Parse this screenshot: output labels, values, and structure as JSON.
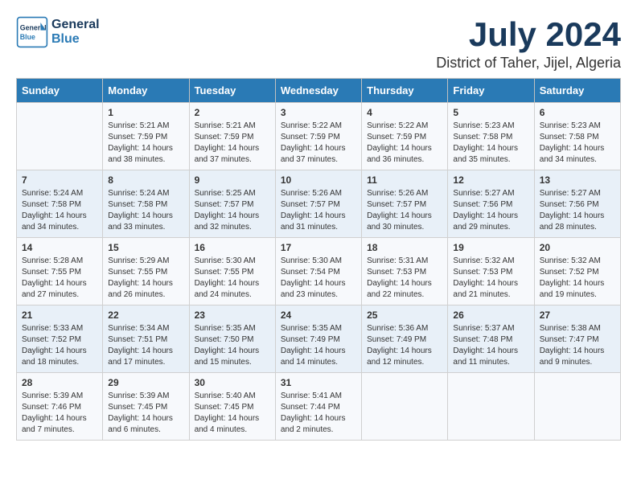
{
  "logo": {
    "general": "General",
    "blue": "Blue"
  },
  "title": "July 2024",
  "subtitle": "District of Taher, Jijel, Algeria",
  "headers": [
    "Sunday",
    "Monday",
    "Tuesday",
    "Wednesday",
    "Thursday",
    "Friday",
    "Saturday"
  ],
  "weeks": [
    [
      {
        "day": "",
        "lines": []
      },
      {
        "day": "1",
        "lines": [
          "Sunrise: 5:21 AM",
          "Sunset: 7:59 PM",
          "Daylight: 14 hours",
          "and 38 minutes."
        ]
      },
      {
        "day": "2",
        "lines": [
          "Sunrise: 5:21 AM",
          "Sunset: 7:59 PM",
          "Daylight: 14 hours",
          "and 37 minutes."
        ]
      },
      {
        "day": "3",
        "lines": [
          "Sunrise: 5:22 AM",
          "Sunset: 7:59 PM",
          "Daylight: 14 hours",
          "and 37 minutes."
        ]
      },
      {
        "day": "4",
        "lines": [
          "Sunrise: 5:22 AM",
          "Sunset: 7:59 PM",
          "Daylight: 14 hours",
          "and 36 minutes."
        ]
      },
      {
        "day": "5",
        "lines": [
          "Sunrise: 5:23 AM",
          "Sunset: 7:58 PM",
          "Daylight: 14 hours",
          "and 35 minutes."
        ]
      },
      {
        "day": "6",
        "lines": [
          "Sunrise: 5:23 AM",
          "Sunset: 7:58 PM",
          "Daylight: 14 hours",
          "and 34 minutes."
        ]
      }
    ],
    [
      {
        "day": "7",
        "lines": [
          "Sunrise: 5:24 AM",
          "Sunset: 7:58 PM",
          "Daylight: 14 hours",
          "and 34 minutes."
        ]
      },
      {
        "day": "8",
        "lines": [
          "Sunrise: 5:24 AM",
          "Sunset: 7:58 PM",
          "Daylight: 14 hours",
          "and 33 minutes."
        ]
      },
      {
        "day": "9",
        "lines": [
          "Sunrise: 5:25 AM",
          "Sunset: 7:57 PM",
          "Daylight: 14 hours",
          "and 32 minutes."
        ]
      },
      {
        "day": "10",
        "lines": [
          "Sunrise: 5:26 AM",
          "Sunset: 7:57 PM",
          "Daylight: 14 hours",
          "and 31 minutes."
        ]
      },
      {
        "day": "11",
        "lines": [
          "Sunrise: 5:26 AM",
          "Sunset: 7:57 PM",
          "Daylight: 14 hours",
          "and 30 minutes."
        ]
      },
      {
        "day": "12",
        "lines": [
          "Sunrise: 5:27 AM",
          "Sunset: 7:56 PM",
          "Daylight: 14 hours",
          "and 29 minutes."
        ]
      },
      {
        "day": "13",
        "lines": [
          "Sunrise: 5:27 AM",
          "Sunset: 7:56 PM",
          "Daylight: 14 hours",
          "and 28 minutes."
        ]
      }
    ],
    [
      {
        "day": "14",
        "lines": [
          "Sunrise: 5:28 AM",
          "Sunset: 7:55 PM",
          "Daylight: 14 hours",
          "and 27 minutes."
        ]
      },
      {
        "day": "15",
        "lines": [
          "Sunrise: 5:29 AM",
          "Sunset: 7:55 PM",
          "Daylight: 14 hours",
          "and 26 minutes."
        ]
      },
      {
        "day": "16",
        "lines": [
          "Sunrise: 5:30 AM",
          "Sunset: 7:55 PM",
          "Daylight: 14 hours",
          "and 24 minutes."
        ]
      },
      {
        "day": "17",
        "lines": [
          "Sunrise: 5:30 AM",
          "Sunset: 7:54 PM",
          "Daylight: 14 hours",
          "and 23 minutes."
        ]
      },
      {
        "day": "18",
        "lines": [
          "Sunrise: 5:31 AM",
          "Sunset: 7:53 PM",
          "Daylight: 14 hours",
          "and 22 minutes."
        ]
      },
      {
        "day": "19",
        "lines": [
          "Sunrise: 5:32 AM",
          "Sunset: 7:53 PM",
          "Daylight: 14 hours",
          "and 21 minutes."
        ]
      },
      {
        "day": "20",
        "lines": [
          "Sunrise: 5:32 AM",
          "Sunset: 7:52 PM",
          "Daylight: 14 hours",
          "and 19 minutes."
        ]
      }
    ],
    [
      {
        "day": "21",
        "lines": [
          "Sunrise: 5:33 AM",
          "Sunset: 7:52 PM",
          "Daylight: 14 hours",
          "and 18 minutes."
        ]
      },
      {
        "day": "22",
        "lines": [
          "Sunrise: 5:34 AM",
          "Sunset: 7:51 PM",
          "Daylight: 14 hours",
          "and 17 minutes."
        ]
      },
      {
        "day": "23",
        "lines": [
          "Sunrise: 5:35 AM",
          "Sunset: 7:50 PM",
          "Daylight: 14 hours",
          "and 15 minutes."
        ]
      },
      {
        "day": "24",
        "lines": [
          "Sunrise: 5:35 AM",
          "Sunset: 7:49 PM",
          "Daylight: 14 hours",
          "and 14 minutes."
        ]
      },
      {
        "day": "25",
        "lines": [
          "Sunrise: 5:36 AM",
          "Sunset: 7:49 PM",
          "Daylight: 14 hours",
          "and 12 minutes."
        ]
      },
      {
        "day": "26",
        "lines": [
          "Sunrise: 5:37 AM",
          "Sunset: 7:48 PM",
          "Daylight: 14 hours",
          "and 11 minutes."
        ]
      },
      {
        "day": "27",
        "lines": [
          "Sunrise: 5:38 AM",
          "Sunset: 7:47 PM",
          "Daylight: 14 hours",
          "and 9 minutes."
        ]
      }
    ],
    [
      {
        "day": "28",
        "lines": [
          "Sunrise: 5:39 AM",
          "Sunset: 7:46 PM",
          "Daylight: 14 hours",
          "and 7 minutes."
        ]
      },
      {
        "day": "29",
        "lines": [
          "Sunrise: 5:39 AM",
          "Sunset: 7:45 PM",
          "Daylight: 14 hours",
          "and 6 minutes."
        ]
      },
      {
        "day": "30",
        "lines": [
          "Sunrise: 5:40 AM",
          "Sunset: 7:45 PM",
          "Daylight: 14 hours",
          "and 4 minutes."
        ]
      },
      {
        "day": "31",
        "lines": [
          "Sunrise: 5:41 AM",
          "Sunset: 7:44 PM",
          "Daylight: 14 hours",
          "and 2 minutes."
        ]
      },
      {
        "day": "",
        "lines": []
      },
      {
        "day": "",
        "lines": []
      },
      {
        "day": "",
        "lines": []
      }
    ]
  ]
}
